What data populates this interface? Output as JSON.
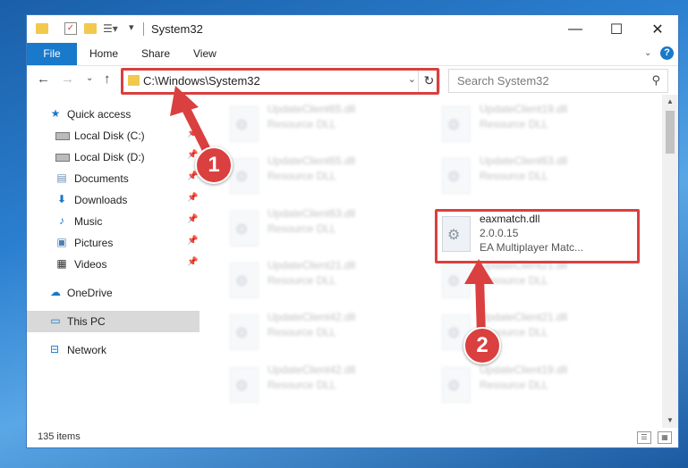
{
  "window": {
    "title": "System32",
    "controls": {
      "minimize": "—",
      "maximize": "☐",
      "close": "✕"
    }
  },
  "ribbon": {
    "tabs": [
      "File",
      "Home",
      "Share",
      "View"
    ]
  },
  "navigation": {
    "address": "C:\\Windows\\System32",
    "search_placeholder": "Search System32"
  },
  "sidebar": {
    "items": [
      {
        "label": "Quick access",
        "icon": "star-icon",
        "pinned": false
      },
      {
        "label": "Local Disk (C:)",
        "icon": "drive-icon",
        "pinned": true
      },
      {
        "label": "Local Disk (D:)",
        "icon": "drive-icon",
        "pinned": true
      },
      {
        "label": "Documents",
        "icon": "documents-icon",
        "pinned": true
      },
      {
        "label": "Downloads",
        "icon": "download-icon",
        "pinned": true
      },
      {
        "label": "Music",
        "icon": "music-icon",
        "pinned": true
      },
      {
        "label": "Pictures",
        "icon": "pictures-icon",
        "pinned": true
      },
      {
        "label": "Videos",
        "icon": "videos-icon",
        "pinned": true
      },
      {
        "label": "OneDrive",
        "icon": "cloud-icon",
        "pinned": false
      },
      {
        "label": "This PC",
        "icon": "computer-icon",
        "pinned": false,
        "selected": true
      },
      {
        "label": "Network",
        "icon": "network-icon",
        "pinned": false
      }
    ]
  },
  "files": {
    "left_column": [
      {
        "name": "UpdateClient65.dll",
        "type": "Resource DLL"
      },
      {
        "name": "UpdateClient65.dll",
        "type": "Resource DLL"
      },
      {
        "name": "UpdateClient63.dll",
        "type": "Resource DLL"
      },
      {
        "name": "UpdateClient21.dll",
        "type": "Resource DLL"
      },
      {
        "name": "UpdateClient42.dll",
        "type": "Resource DLL"
      },
      {
        "name": "UpdateClient42.dll",
        "type": "Resource DLL"
      }
    ],
    "right_column": [
      {
        "name": "UpdateClient19.dll",
        "type": "Resource DLL"
      },
      {
        "name": "UpdateClient63.dll",
        "type": "Resource DLL"
      },
      {
        "name": "eaxmatch.dll",
        "version": "2.0.0.15",
        "description": "EA Multiplayer Matc..."
      },
      {
        "name": "UpdateClient21.dll",
        "type": "Resource DLL"
      },
      {
        "name": "UpdateClient21.dll",
        "type": "Resource DLL"
      },
      {
        "name": "UpdateClient19.dll",
        "type": "Resource DLL"
      }
    ]
  },
  "status": {
    "item_count": "135 items"
  },
  "annotations": {
    "step1": "1",
    "step2": "2",
    "color": "#d9403f"
  }
}
